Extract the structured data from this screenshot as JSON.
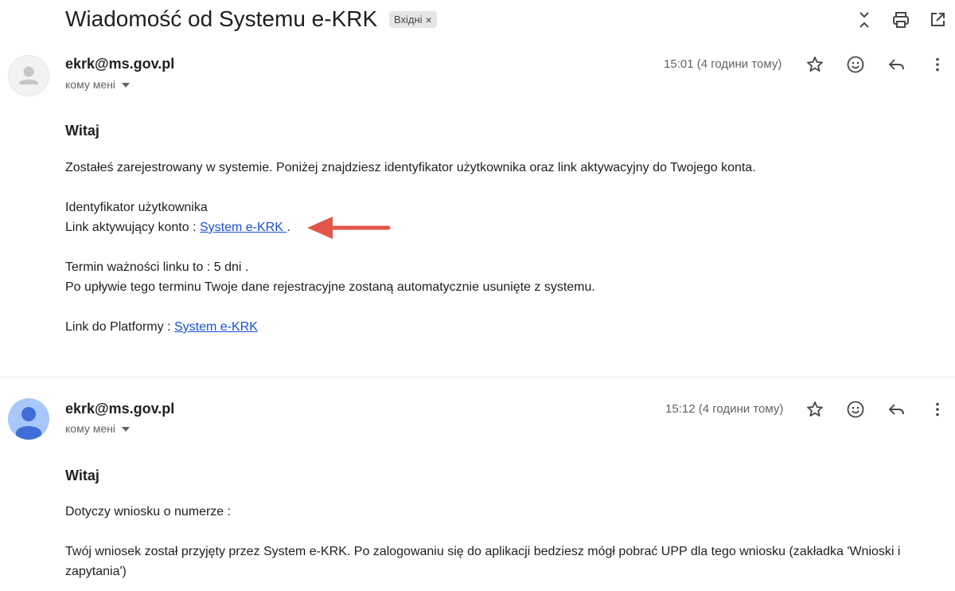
{
  "thread": {
    "subject": "Wiadomość od Systemu e-KRK",
    "label": "Вхідні",
    "label_close": "×"
  },
  "icons": {
    "header": [
      "collapse-all-icon",
      "print-icon",
      "open-new-window-icon"
    ],
    "message": [
      "star-icon",
      "emoji-icon",
      "reply-icon",
      "more-vert-icon"
    ]
  },
  "messages": [
    {
      "sender": "ekrk@ms.gov.pl",
      "recipient": "кому мені",
      "time": "15:01 (4 години тому)",
      "greeting": "Witaj",
      "p1": "Zostałeś zarejestrowany w systemie. Poniżej znajdziesz identyfikator użytkownika oraz link aktywacyjny do Twojego konta.",
      "id_label": "Identyfikator użytkownika",
      "activation_prefix": "Link aktywujący konto : ",
      "activation_link": "System e-KRK ",
      "activation_suffix": ".",
      "validity": "Termin ważności linku to : 5 dni .",
      "expiry_note": "Po upływie tego terminu Twoje dane rejestracyjne zostaną automatycznie usunięte z systemu.",
      "platform_prefix": "Link do Platformy : ",
      "platform_link": "System e-KRK"
    },
    {
      "sender": "ekrk@ms.gov.pl",
      "recipient": "кому мені",
      "time": "15:12 (4 години тому)",
      "greeting": "Witaj",
      "p1": "Dotyczy wniosku o numerze :",
      "p2": "Twój wniosek został przyjęty przez System e-KRK. Po zalogowaniu się do aplikacji bedziesz mógł pobrać UPP dla tego wniosku (zakładka 'Wnioski i zapytania')"
    }
  ],
  "colors": {
    "link": "#1a4fd6",
    "arrow": "#e0564a",
    "avatar_blue": "#a8c7fa",
    "avatar_icon_blue": "#3f6fd6"
  }
}
